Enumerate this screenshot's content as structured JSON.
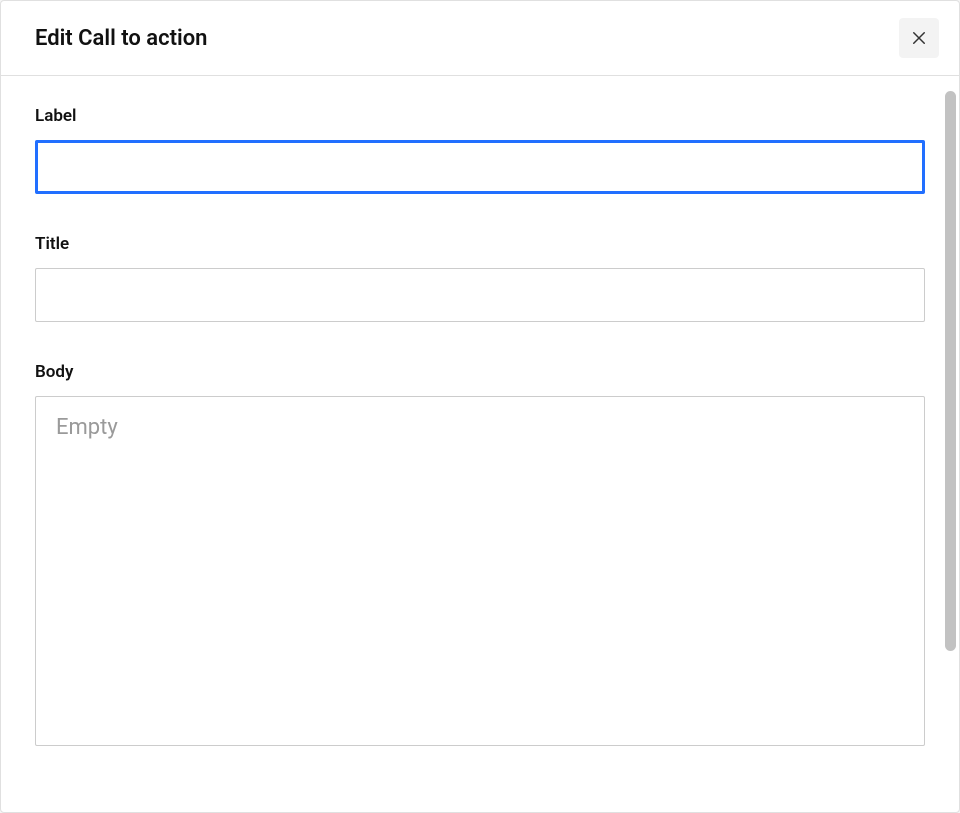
{
  "modal": {
    "title": "Edit Call to action",
    "fields": {
      "label": {
        "label": "Label",
        "value": ""
      },
      "title": {
        "label": "Title",
        "value": ""
      },
      "body": {
        "label": "Body",
        "placeholder": "Empty",
        "value": ""
      }
    }
  }
}
